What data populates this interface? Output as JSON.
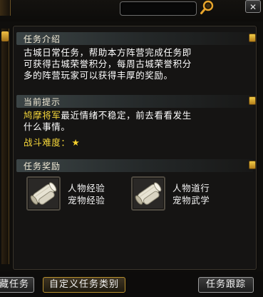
{
  "header": {
    "close_label": "✕"
  },
  "sections": {
    "intro": {
      "title": "任务介绍",
      "lines": [
        "古城日常任务，帮助本方阵营完成任务即",
        "可获得古城荣誉积分，每周古城荣誉积分",
        "多的阵营玩家可以获得丰厚的奖励。"
      ]
    },
    "hint": {
      "title": "当前提示",
      "npc": "鸠摩将军",
      "line1_rest": "最近情绪不稳定，前去看看发生",
      "line2": "什么事情。",
      "difficulty_label": "战斗难度：",
      "difficulty_stars": 1,
      "star_glyph": "★"
    },
    "rewards": {
      "title": "任务奖励",
      "items": [
        {
          "line1": "人物经验",
          "line2": "宠物经验",
          "icon": "scroll-icon"
        },
        {
          "line1": "人物道行",
          "line2": "宠物武学",
          "icon": "scroll-icon"
        }
      ]
    }
  },
  "buttons": {
    "left": "藏任务",
    "custom": "自定义任务类别",
    "track": "任务跟踪"
  },
  "colors": {
    "npc": "#f5d63a",
    "text": "#ffffff",
    "header_bar": "#485456",
    "gold": "#f0c043"
  }
}
